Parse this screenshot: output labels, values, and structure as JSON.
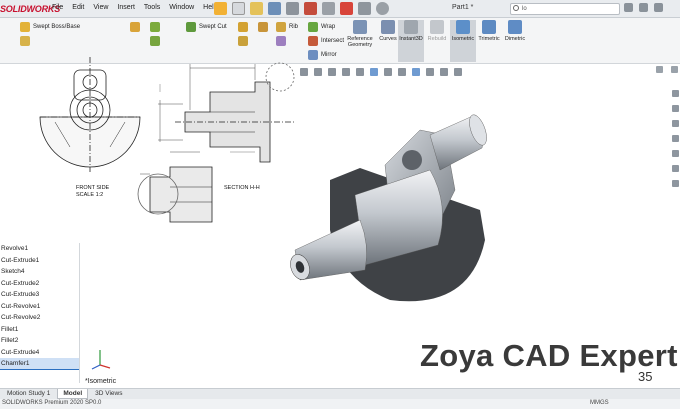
{
  "app": {
    "logo": "SOLIDWORKS",
    "menus": [
      "File",
      "Edit",
      "View",
      "Insert",
      "Tools",
      "Window",
      "Help"
    ],
    "document_title": "Part1 *",
    "search_placeholder": "lo"
  },
  "command_manager": {
    "small_features": [
      "Swept Boss/Base",
      "Swept Cut",
      "Rib",
      "Wrap",
      "Intersect",
      "Mirror"
    ],
    "big_buttons": [
      "Reference Geometry",
      "Curves",
      "Instant3D",
      "Rebuild",
      "Isometric",
      "Trimetric",
      "Dimetric"
    ],
    "active_big": "Isometric"
  },
  "drawing": {
    "front_view_label": "FRONT SIDE",
    "front_scale": "SCALE 1:2",
    "section_label": "SECTION H-H"
  },
  "feature_tree": {
    "items": [
      "Revolve1",
      "Cut-Extrude1",
      "Sketch4",
      "Cut-Extrude2",
      "Cut-Extrude3",
      "Cut-Revolve1",
      "Cut-Revolve2",
      "Fillet1",
      "Fillet2",
      "Cut-Extrude4",
      "Chamfer1"
    ],
    "selected_index": 10
  },
  "tabs": [
    "Motion Study 1",
    "Model",
    "3D Views"
  ],
  "active_tab": "Model",
  "view_label": "*Isometric",
  "watermark": "Zoya CAD Expert",
  "slide_number": "35",
  "status": {
    "text": "SOLIDWORKS Premium 2020 SP0.0",
    "units": "MMGS"
  },
  "colors": {
    "brand_red": "#c8102e",
    "accent_blue": "#2b6fc0",
    "part_grey": "#a4a9b0"
  }
}
